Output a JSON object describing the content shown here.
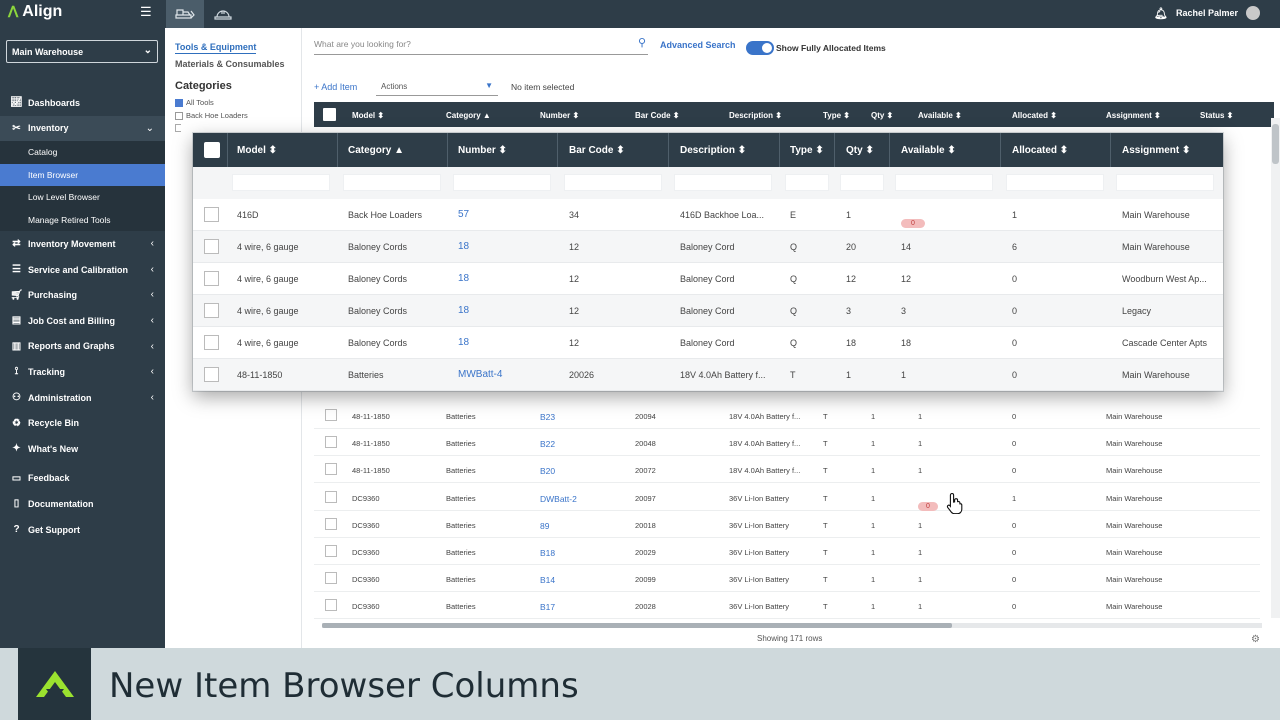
{
  "app": {
    "name": "Align",
    "user": "Rachel Palmer"
  },
  "sidebar": {
    "warehouse": "Main Warehouse",
    "items": [
      {
        "label": "Dashboards"
      },
      {
        "label": "Inventory"
      },
      {
        "label": "Catalog"
      },
      {
        "label": "Item Browser"
      },
      {
        "label": "Low Level Browser"
      },
      {
        "label": "Manage Retired Tools"
      },
      {
        "label": "Inventory Movement"
      },
      {
        "label": "Service and Calibration"
      },
      {
        "label": "Purchasing"
      },
      {
        "label": "Job Cost and Billing"
      },
      {
        "label": "Reports and Graphs"
      },
      {
        "label": "Tracking"
      },
      {
        "label": "Administration"
      },
      {
        "label": "Recycle Bin"
      },
      {
        "label": "What's New"
      },
      {
        "label": "Feedback"
      },
      {
        "label": "Documentation"
      },
      {
        "label": "Get Support"
      }
    ]
  },
  "categories": {
    "tab_tools": "Tools & Equipment",
    "tab_materials": "Materials & Consumables",
    "heading": "Categories",
    "all_tools": "All Tools",
    "back_hoe": "Back Hoe Loaders"
  },
  "toolbar": {
    "search_placeholder": "What are you looking for?",
    "advanced_search": "Advanced Search",
    "toggle_label": "Show Fully Allocated Items",
    "add_item": "+ Add Item",
    "actions": "Actions",
    "no_selection": "No item selected"
  },
  "table": {
    "headers": {
      "model": "Model ⬍",
      "category": "Category ▲",
      "number": "Number ⬍",
      "barcode": "Bar Code ⬍",
      "description": "Description ⬍",
      "type": "Type ⬍",
      "qty": "Qty ⬍",
      "available": "Available ⬍",
      "allocated": "Allocated ⬍",
      "assignment": "Assignment ⬍",
      "status": "Status ⬍"
    },
    "rows": [
      {
        "model": "48-11-1850",
        "category": "Batteries",
        "number": "B23",
        "barcode": "20094",
        "description": "18V 4.0Ah Battery f...",
        "type": "T",
        "qty": "1",
        "available": "1",
        "allocated": "0",
        "assignment": "Main Warehouse"
      },
      {
        "model": "48-11-1850",
        "category": "Batteries",
        "number": "B22",
        "barcode": "20048",
        "description": "18V 4.0Ah Battery f...",
        "type": "T",
        "qty": "1",
        "available": "1",
        "allocated": "0",
        "assignment": "Main Warehouse"
      },
      {
        "model": "48-11-1850",
        "category": "Batteries",
        "number": "B20",
        "barcode": "20072",
        "description": "18V 4.0Ah Battery f...",
        "type": "T",
        "qty": "1",
        "available": "1",
        "allocated": "0",
        "assignment": "Main Warehouse"
      },
      {
        "model": "DC9360",
        "category": "Batteries",
        "number": "DWBatt-2",
        "barcode": "20097",
        "description": "36V Li-Ion Battery",
        "type": "T",
        "qty": "1",
        "available": "0",
        "allocated": "1",
        "assignment": "Main Warehouse"
      },
      {
        "model": "DC9360",
        "category": "Batteries",
        "number": "89",
        "barcode": "20018",
        "description": "36V Li-Ion Battery",
        "type": "T",
        "qty": "1",
        "available": "1",
        "allocated": "0",
        "assignment": "Main Warehouse"
      },
      {
        "model": "DC9360",
        "category": "Batteries",
        "number": "B18",
        "barcode": "20029",
        "description": "36V Li-Ion Battery",
        "type": "T",
        "qty": "1",
        "available": "1",
        "allocated": "0",
        "assignment": "Main Warehouse"
      },
      {
        "model": "DC9360",
        "category": "Batteries",
        "number": "B14",
        "barcode": "20099",
        "description": "36V Li-Ion Battery",
        "type": "T",
        "qty": "1",
        "available": "1",
        "allocated": "0",
        "assignment": "Main Warehouse"
      },
      {
        "model": "DC9360",
        "category": "Batteries",
        "number": "B17",
        "barcode": "20028",
        "description": "36V Li-Ion Battery",
        "type": "T",
        "qty": "1",
        "available": "1",
        "allocated": "0",
        "assignment": "Main Warehouse"
      }
    ],
    "footer": "Showing 171 rows"
  },
  "zoom": {
    "rows": [
      {
        "model": "416D",
        "category": "Back Hoe Loaders",
        "number": "57",
        "barcode": "34",
        "description": "416D Backhoe Loa...",
        "type": "E",
        "qty": "1",
        "available": "0",
        "allocated": "1",
        "assignment": "Main Warehouse"
      },
      {
        "model": "4 wire, 6 gauge",
        "category": "Baloney Cords",
        "number": "18",
        "barcode": "12",
        "description": "Baloney Cord",
        "type": "Q",
        "qty": "20",
        "available": "14",
        "allocated": "6",
        "assignment": "Main Warehouse"
      },
      {
        "model": "4 wire, 6 gauge",
        "category": "Baloney Cords",
        "number": "18",
        "barcode": "12",
        "description": "Baloney Cord",
        "type": "Q",
        "qty": "12",
        "available": "12",
        "allocated": "0",
        "assignment": "Woodburn West Ap..."
      },
      {
        "model": "4 wire, 6 gauge",
        "category": "Baloney Cords",
        "number": "18",
        "barcode": "12",
        "description": "Baloney Cord",
        "type": "Q",
        "qty": "3",
        "available": "3",
        "allocated": "0",
        "assignment": "Legacy"
      },
      {
        "model": "4 wire, 6 gauge",
        "category": "Baloney Cords",
        "number": "18",
        "barcode": "12",
        "description": "Baloney Cord",
        "type": "Q",
        "qty": "18",
        "available": "18",
        "allocated": "0",
        "assignment": "Cascade Center Apts"
      },
      {
        "model": "48-11-1850",
        "category": "Batteries",
        "number": "MWBatt-4",
        "barcode": "20026",
        "description": "18V 4.0Ah Battery f...",
        "type": "T",
        "qty": "1",
        "available": "1",
        "allocated": "0",
        "assignment": "Main Warehouse"
      }
    ]
  },
  "banner": {
    "title": "New Item Browser Columns"
  },
  "colors": {
    "navy": "#2e3d48",
    "accent": "#3a74c9",
    "brand_green": "#8cd63c",
    "banner_bg": "#cfd9dc"
  },
  "icons": [
    "menu-icon",
    "bulldozer-icon",
    "hardhat-icon",
    "bell-icon",
    "search-icon",
    "gear-icon",
    "hand-cursor-icon"
  ]
}
